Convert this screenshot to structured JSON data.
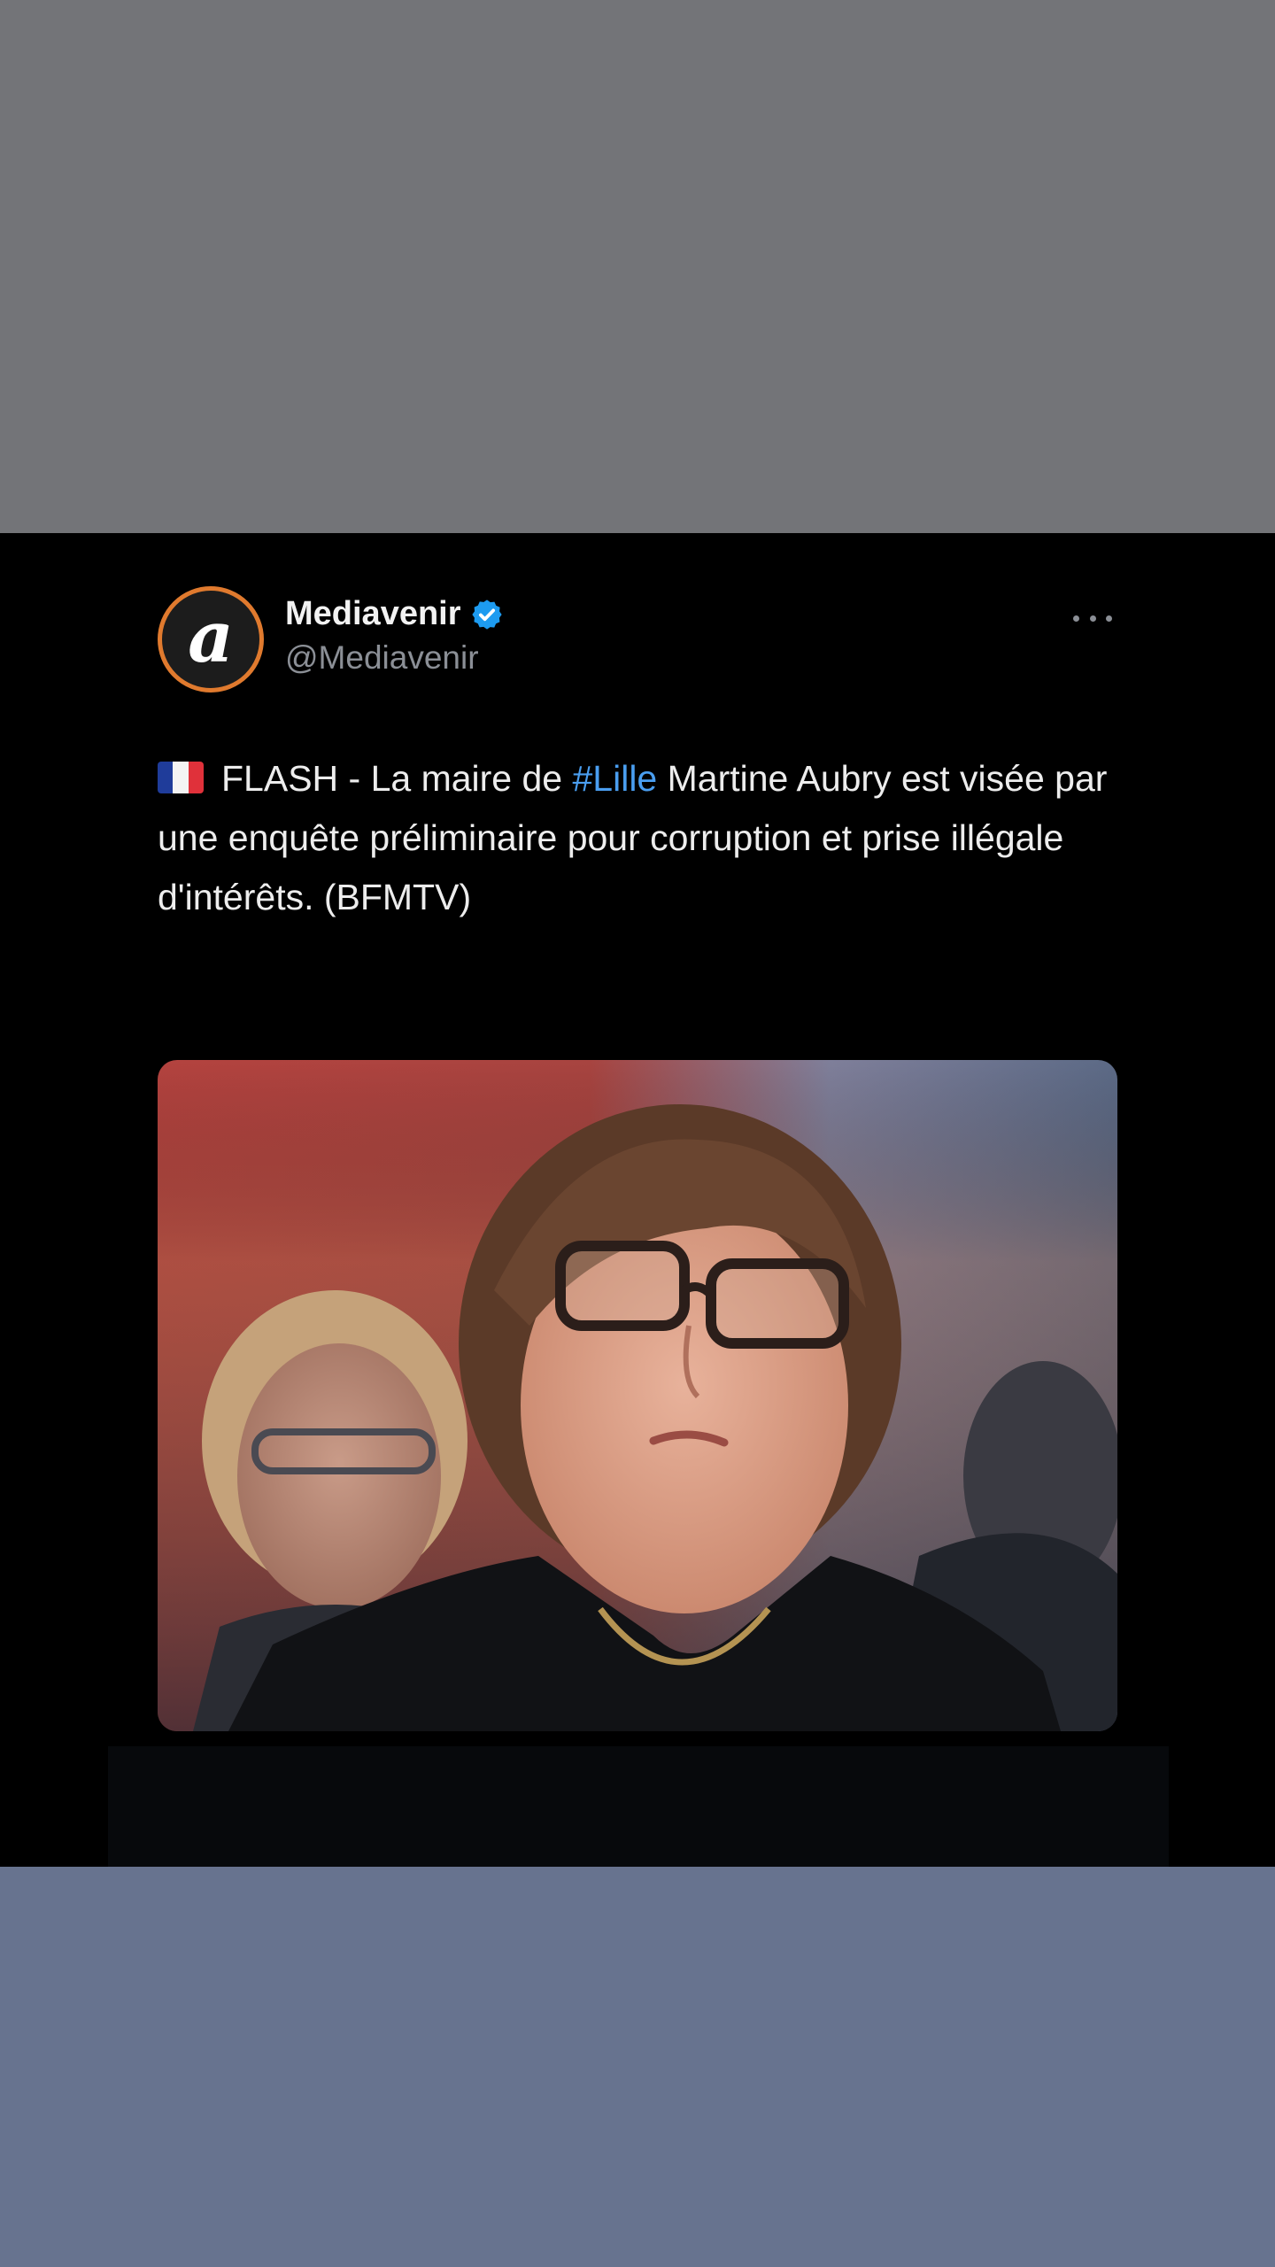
{
  "tweet": {
    "display_name": "Mediavenir",
    "handle": "@Mediavenir",
    "avatar_letter": "a",
    "verified_icon": "verified-badge-icon",
    "more_icon": "more-options-icon",
    "flag_icon": "flag-france-icon",
    "text_part1": "FLASH - La maire de ",
    "hashtag": "#Lille",
    "text_part2": " Martine Aubry est visée par une enquête préliminaire pour corruption et prise illégale d'intérêts. (BFMTV)",
    "media_icon": "news-photo-image"
  },
  "colors": {
    "top_band": "#737478",
    "bottom_band": "#67738f",
    "panel": "#000000",
    "hashtag": "#4a9ef0",
    "avatar_ring": "#e07a2e",
    "verified": "#1d9bf0"
  }
}
